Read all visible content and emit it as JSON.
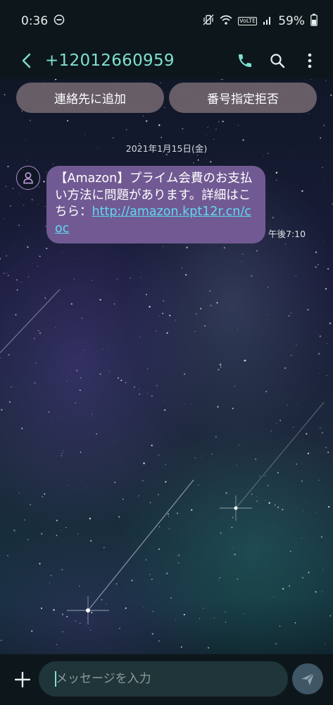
{
  "status_bar": {
    "time": "0:36",
    "battery": "59%",
    "volte": "VoLTE"
  },
  "app_bar": {
    "contact": "+12012660959",
    "accent_color": "#7fe0d0"
  },
  "actions": {
    "add_contact_label": "連絡先に追加",
    "block_number_label": "番号指定拒否"
  },
  "conversation": {
    "date": "2021年1月15日(金)",
    "message": {
      "text": "【Amazon】プライム会費のお支払い方法に問題があります。詳細はこちら：",
      "link": "http://amazon.kpt12r.cn/coc",
      "time": "午後7:10",
      "bubble_color": "#715a93"
    }
  },
  "compose": {
    "placeholder": "メッセージを入力"
  },
  "icons": {
    "status": [
      "do-not-disturb-icon",
      "vibrate-icon",
      "wifi-icon",
      "volte-icon",
      "signal-icon",
      "battery-icon"
    ],
    "app_bar": [
      "back-arrow-icon",
      "phone-icon",
      "search-icon",
      "more-options-icon"
    ],
    "compose": [
      "plus-icon",
      "send-icon"
    ],
    "avatar": "person-icon"
  }
}
